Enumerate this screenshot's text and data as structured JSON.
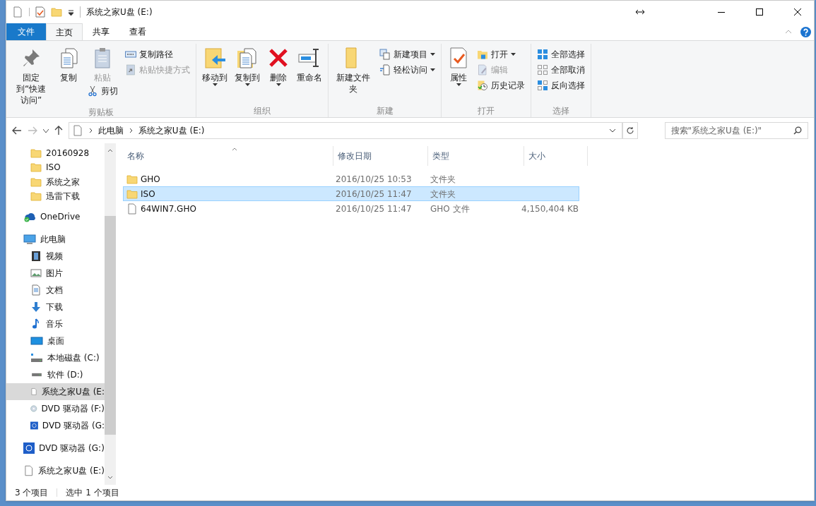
{
  "window": {
    "title": "系统之家U盘 (E:)"
  },
  "tabs": [
    {
      "label": "文件",
      "kind": "file",
      "selected": false
    },
    {
      "label": "主页",
      "kind": "tab",
      "selected": true
    },
    {
      "label": "共享",
      "kind": "tab",
      "selected": false
    },
    {
      "label": "查看",
      "kind": "tab",
      "selected": false
    }
  ],
  "ribbon": {
    "groups": [
      {
        "label": "剪贴板",
        "columns": [
          [
            {
              "label": "固定到“快速访问”",
              "kind": "large",
              "disabled": false
            }
          ],
          [
            {
              "label": "复制",
              "kind": "large",
              "disabled": false
            }
          ],
          [
            {
              "label": "粘贴",
              "kind": "large",
              "disabled": true
            },
            {
              "label": "剪切",
              "kind": "small",
              "disabled": false
            }
          ],
          [
            {
              "label": "复制路径",
              "kind": "small",
              "disabled": false
            },
            {
              "label": "粘贴快捷方式",
              "kind": "small",
              "disabled": true
            }
          ]
        ]
      },
      {
        "label": "组织",
        "columns": [
          [
            {
              "label": "移动到",
              "kind": "large",
              "dropdown": true,
              "disabled": false
            }
          ],
          [
            {
              "label": "复制到",
              "kind": "large",
              "dropdown": true,
              "disabled": false
            }
          ],
          [
            {
              "label": "删除",
              "kind": "large",
              "dropdown": true,
              "disabled": false
            }
          ],
          [
            {
              "label": "重命名",
              "kind": "large",
              "disabled": false
            }
          ]
        ]
      },
      {
        "label": "新建",
        "columns": [
          [
            {
              "label": "新建文件夹",
              "kind": "large",
              "disabled": false
            }
          ],
          [
            {
              "label": "新建项目",
              "kind": "small",
              "dropdown": true,
              "disabled": false
            },
            {
              "label": "轻松访问",
              "kind": "small",
              "dropdown": true,
              "disabled": false
            }
          ]
        ]
      },
      {
        "label": "打开",
        "columns": [
          [
            {
              "label": "属性",
              "kind": "large",
              "dropdown": true,
              "disabled": false
            }
          ],
          [
            {
              "label": "打开",
              "kind": "small",
              "dropdown": true,
              "disabled": false
            },
            {
              "label": "编辑",
              "kind": "small",
              "disabled": true
            },
            {
              "label": "历史记录",
              "kind": "small",
              "disabled": false
            }
          ]
        ]
      },
      {
        "label": "选择",
        "columns": [
          [
            {
              "label": "全部选择",
              "kind": "small",
              "disabled": false
            },
            {
              "label": "全部取消",
              "kind": "small",
              "disabled": false
            },
            {
              "label": "反向选择",
              "kind": "small",
              "disabled": false
            }
          ]
        ]
      }
    ]
  },
  "address": {
    "path": [
      "此电脑",
      "系统之家U盘 (E:)"
    ],
    "search_placeholder": "搜索\"系统之家U盘 (E:)\""
  },
  "sidebar": {
    "quick_access_items": [
      {
        "label": "20160928",
        "kind": "folder",
        "selected": false
      },
      {
        "label": "ISO",
        "kind": "folder",
        "selected": false
      },
      {
        "label": "系统之家",
        "kind": "folder",
        "selected": false
      },
      {
        "label": "迅雷下载",
        "kind": "folder",
        "selected": false
      }
    ],
    "items": [
      {
        "label": "OneDrive",
        "kind": "onedrive",
        "selected": false
      },
      {
        "label": "此电脑",
        "kind": "pc",
        "selected": false,
        "children": [
          {
            "label": "视频",
            "kind": "video",
            "selected": false
          },
          {
            "label": "图片",
            "kind": "picture",
            "selected": false
          },
          {
            "label": "文档",
            "kind": "document",
            "selected": false
          },
          {
            "label": "下载",
            "kind": "download",
            "selected": false
          },
          {
            "label": "音乐",
            "kind": "music",
            "selected": false
          },
          {
            "label": "桌面",
            "kind": "desktop",
            "selected": false
          },
          {
            "label": "本地磁盘 (C:)",
            "kind": "system-drive",
            "selected": false
          },
          {
            "label": "软件 (D:)",
            "kind": "drive",
            "selected": false
          },
          {
            "label": "系统之家U盘 (E:",
            "kind": "file",
            "selected": true
          },
          {
            "label": "DVD 驱动器 (F:)",
            "kind": "dvd",
            "selected": false
          },
          {
            "label": "DVD 驱动器 (G:",
            "kind": "dvd-blue",
            "selected": false
          }
        ]
      },
      {
        "label": "DVD 驱动器 (G:)",
        "kind": "dvd-blue",
        "selected": false
      },
      {
        "label": "系统之家U盘 (E:)",
        "kind": "file",
        "selected": false
      }
    ]
  },
  "table": {
    "columns": [
      "名称",
      "修改日期",
      "类型",
      "大小"
    ],
    "rows": [
      {
        "kind": "folder",
        "cells": [
          "GHO",
          "2016/10/25 10:53",
          "文件夹",
          ""
        ],
        "selected": false
      },
      {
        "kind": "folder",
        "cells": [
          "ISO",
          "2016/10/25 11:47",
          "文件夹",
          ""
        ],
        "selected": true
      },
      {
        "kind": "file",
        "cells": [
          "64WIN7.GHO",
          "2016/10/25 11:47",
          "GHO 文件",
          "4,150,404 KB"
        ],
        "selected": false
      }
    ]
  },
  "status_bar": {
    "count": "3 个项目",
    "selection": "选中 1 个项目"
  }
}
